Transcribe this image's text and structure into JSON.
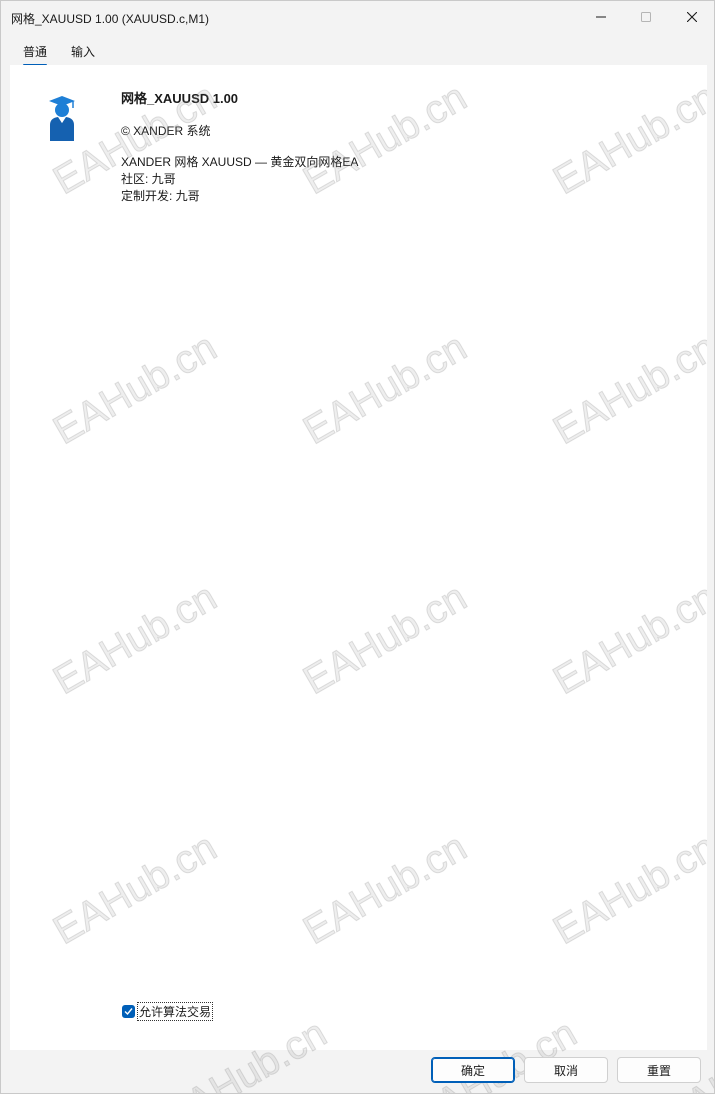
{
  "window": {
    "title": "网格_XAUUSD 1.00 (XAUUSD.c,M1)"
  },
  "tabs": [
    {
      "label": "普通",
      "active": true
    },
    {
      "label": "输入",
      "active": false
    }
  ],
  "ea": {
    "name": "网格_XAUUSD 1.00",
    "copyright": "© XANDER 系统",
    "description": [
      "XANDER 网格 XAUUSD — 黄金双向网格EA",
      "社区: 九哥",
      "定制开发: 九哥"
    ]
  },
  "watermark": "EAHub.cn",
  "options": {
    "allow_algo_trading_label": "允许算法交易",
    "allow_algo_trading_checked": true
  },
  "buttons": {
    "ok": "确定",
    "cancel": "取消",
    "reset": "重置"
  },
  "colors": {
    "accent": "#005fb8",
    "content_bg": "#ffffff",
    "window_bg": "#f3f3f3",
    "icon_blue": "#1e7fd6"
  }
}
